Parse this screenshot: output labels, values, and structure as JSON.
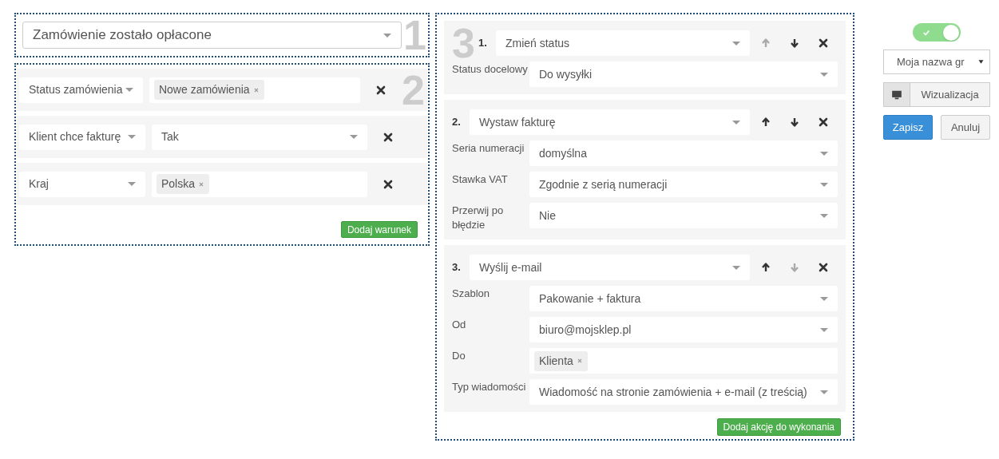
{
  "trigger": {
    "number": "1",
    "value": "Zamówienie zostało opłacone"
  },
  "conditions": {
    "number": "2",
    "rows": [
      {
        "field": "Status zamówienia",
        "kind": "tags",
        "tags": [
          "Nowe zamówienia"
        ]
      },
      {
        "field": "Klient chce fakturę",
        "kind": "select",
        "value": "Tak"
      },
      {
        "field": "Kraj",
        "kind": "tags",
        "tags": [
          "Polska"
        ]
      }
    ],
    "add_button": "Dodaj warunek"
  },
  "actions": {
    "number": "3",
    "items": [
      {
        "index": "1.",
        "type": "Zmień status",
        "up_disabled": true,
        "down_disabled": false,
        "params": [
          {
            "label": "Status docelowy",
            "kind": "select",
            "value": "Do wysyłki"
          }
        ]
      },
      {
        "index": "2.",
        "type": "Wystaw fakturę",
        "up_disabled": false,
        "down_disabled": false,
        "params": [
          {
            "label": "Seria numeracji",
            "kind": "select",
            "value": "domyślna"
          },
          {
            "label": "Stawka VAT",
            "kind": "select",
            "value": "Zgodnie z serią numeracji"
          },
          {
            "label": "Przerwij po błędzie",
            "kind": "select",
            "value": "Nie"
          }
        ]
      },
      {
        "index": "3.",
        "type": "Wyślij e-mail",
        "up_disabled": false,
        "down_disabled": true,
        "params": [
          {
            "label": "Szablon",
            "kind": "select",
            "value": "Pakowanie + faktura"
          },
          {
            "label": "Od",
            "kind": "select",
            "value": "biuro@mojsklep.pl"
          },
          {
            "label": "Do",
            "kind": "tags",
            "tags": [
              "Klienta"
            ]
          },
          {
            "label": "Typ wiadomości",
            "kind": "select",
            "value": "Wiadomość na stronie zamówienia + e-mail (z treścią)"
          }
        ]
      }
    ],
    "add_button": "Dodaj akcję do wykonania"
  },
  "sidebar": {
    "toggle": {
      "on": true
    },
    "group_select": "Moja nazwa gr",
    "visualize_button": "Wizualizacja",
    "save_button": "Zapisz",
    "cancel_button": "Anuluj"
  }
}
